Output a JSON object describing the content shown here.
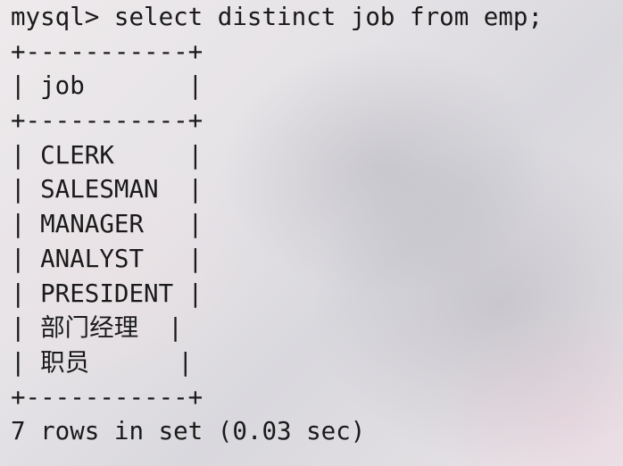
{
  "terminal": {
    "prompt": "mysql>",
    "command": " select distinct job from emp;",
    "border_line": "+-----------+",
    "header_line": "| job       |",
    "rows": [
      "| CLERK     |",
      "| SALESMAN  |",
      "| MANAGER   |",
      "| ANALYST   |",
      "| PRESIDENT |",
      "| 部门经理  |",
      "| 职员      |"
    ],
    "result_summary": "7 rows in set (0.03 sec)"
  }
}
